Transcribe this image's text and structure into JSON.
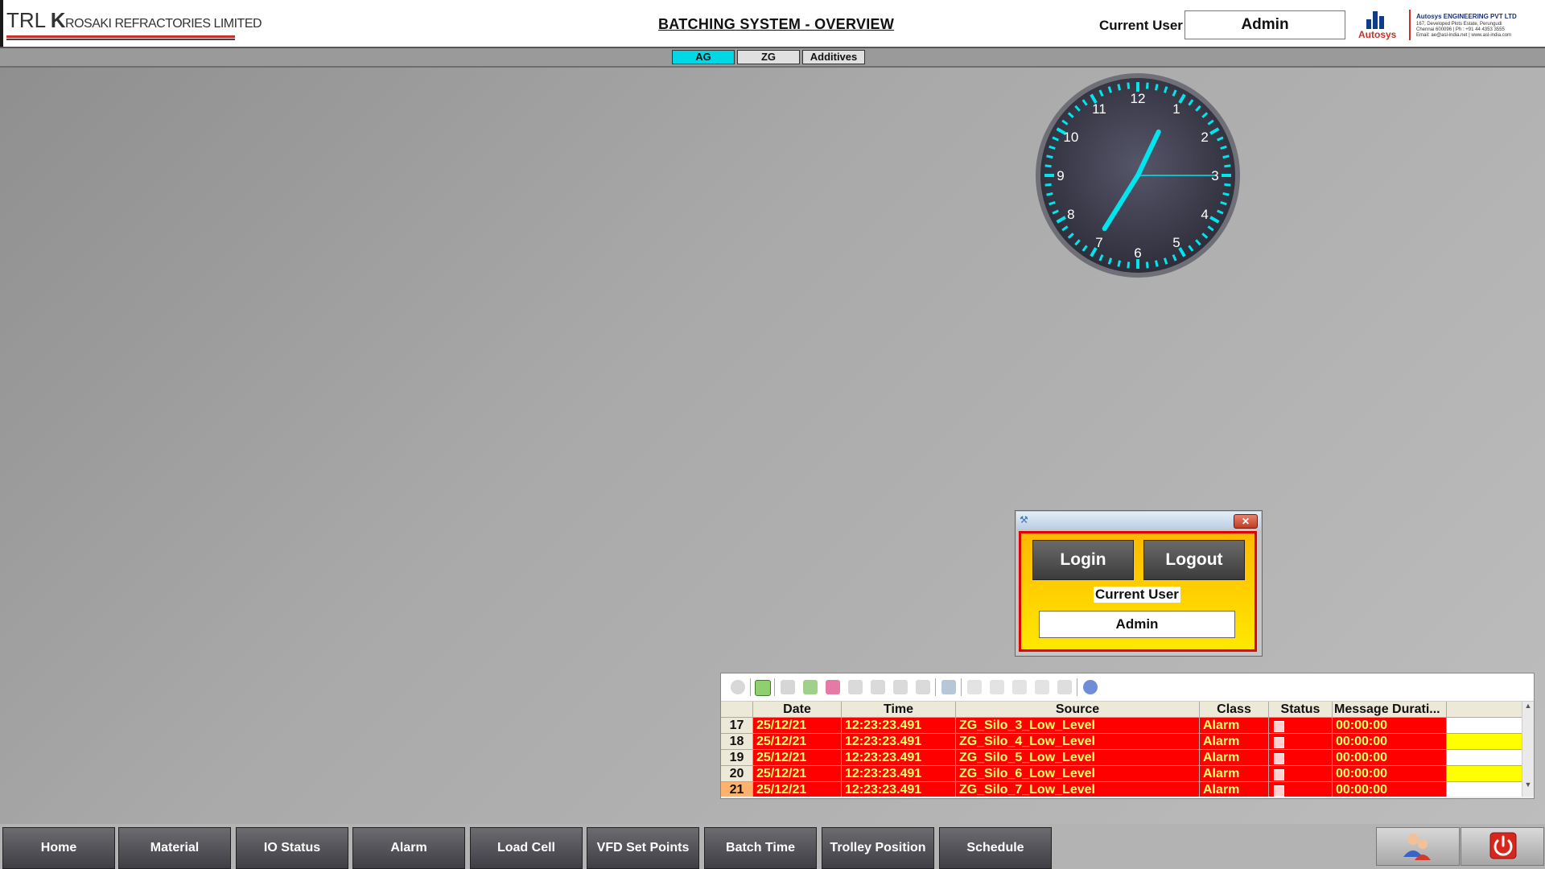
{
  "header": {
    "brand_trl": "TRL",
    "brand_k": "K",
    "brand_rest": "ROSAKI REFRACTORIES LIMITED",
    "title": "BATCHING SYSTEM - OVERVIEW",
    "current_user_label": "Current User",
    "current_user_value": "Admin",
    "partner_name": "Autosys",
    "partner_company": "Autosys ENGINEERING PVT LTD",
    "partner_address": [
      "167, Developed Plots Estate, Perungudi",
      "Chennai 600096 | Ph : +91 44 4353 3555",
      "Email: ae@asl-india.net | www.asl-india.com"
    ]
  },
  "tabs": [
    {
      "label": "AG",
      "active": true
    },
    {
      "label": "ZG",
      "active": false
    },
    {
      "label": "Additives",
      "active": false
    }
  ],
  "clock": {
    "numbers": [
      "12",
      "1",
      "2",
      "3",
      "4",
      "5",
      "6",
      "7",
      "8",
      "9",
      "10",
      "11"
    ],
    "hour": 7,
    "minute": 4,
    "second": 15,
    "accent_color": "#00e5ee"
  },
  "login_popup": {
    "login_label": "Login",
    "logout_label": "Logout",
    "current_user_label": "Current User",
    "current_user_value": "Admin",
    "close_icon": "close-icon",
    "app_icon": "wrench-icon"
  },
  "alarm_table": {
    "columns": [
      "Date",
      "Time",
      "Source",
      "Class",
      "Status",
      "Message Durati..."
    ],
    "rows": [
      {
        "num": "17",
        "date": "25/12/21",
        "time": "12:23:23.491",
        "source": "ZG_Silo_3_Low_Level",
        "class": "Alarm",
        "duration": "00:00:00",
        "ack": "white"
      },
      {
        "num": "18",
        "date": "25/12/21",
        "time": "12:23:23.491",
        "source": "ZG_Silo_4_Low_Level",
        "class": "Alarm",
        "duration": "00:00:00",
        "ack": "yellow"
      },
      {
        "num": "19",
        "date": "25/12/21",
        "time": "12:23:23.491",
        "source": "ZG_Silo_5_Low_Level",
        "class": "Alarm",
        "duration": "00:00:00",
        "ack": "white"
      },
      {
        "num": "20",
        "date": "25/12/21",
        "time": "12:23:23.491",
        "source": "ZG_Silo_6_Low_Level",
        "class": "Alarm",
        "duration": "00:00:00",
        "ack": "yellow"
      },
      {
        "num": "21",
        "date": "25/12/21",
        "time": "12:23:23.491",
        "source": "ZG_Silo_7_Low_Level",
        "class": "Alarm",
        "duration": "00:00:00",
        "ack": "white"
      }
    ],
    "alarm_color": "#ff0000",
    "alarm_text_color": "#ffff66"
  },
  "nav": {
    "buttons": [
      "Home",
      "Material",
      "IO Status",
      "Alarm",
      "Load Cell",
      "VFD Set Points",
      "Batch Time",
      "Trolley Position",
      "Schedule"
    ],
    "user_icon": "user-management-icon",
    "power_icon": "power-icon"
  }
}
